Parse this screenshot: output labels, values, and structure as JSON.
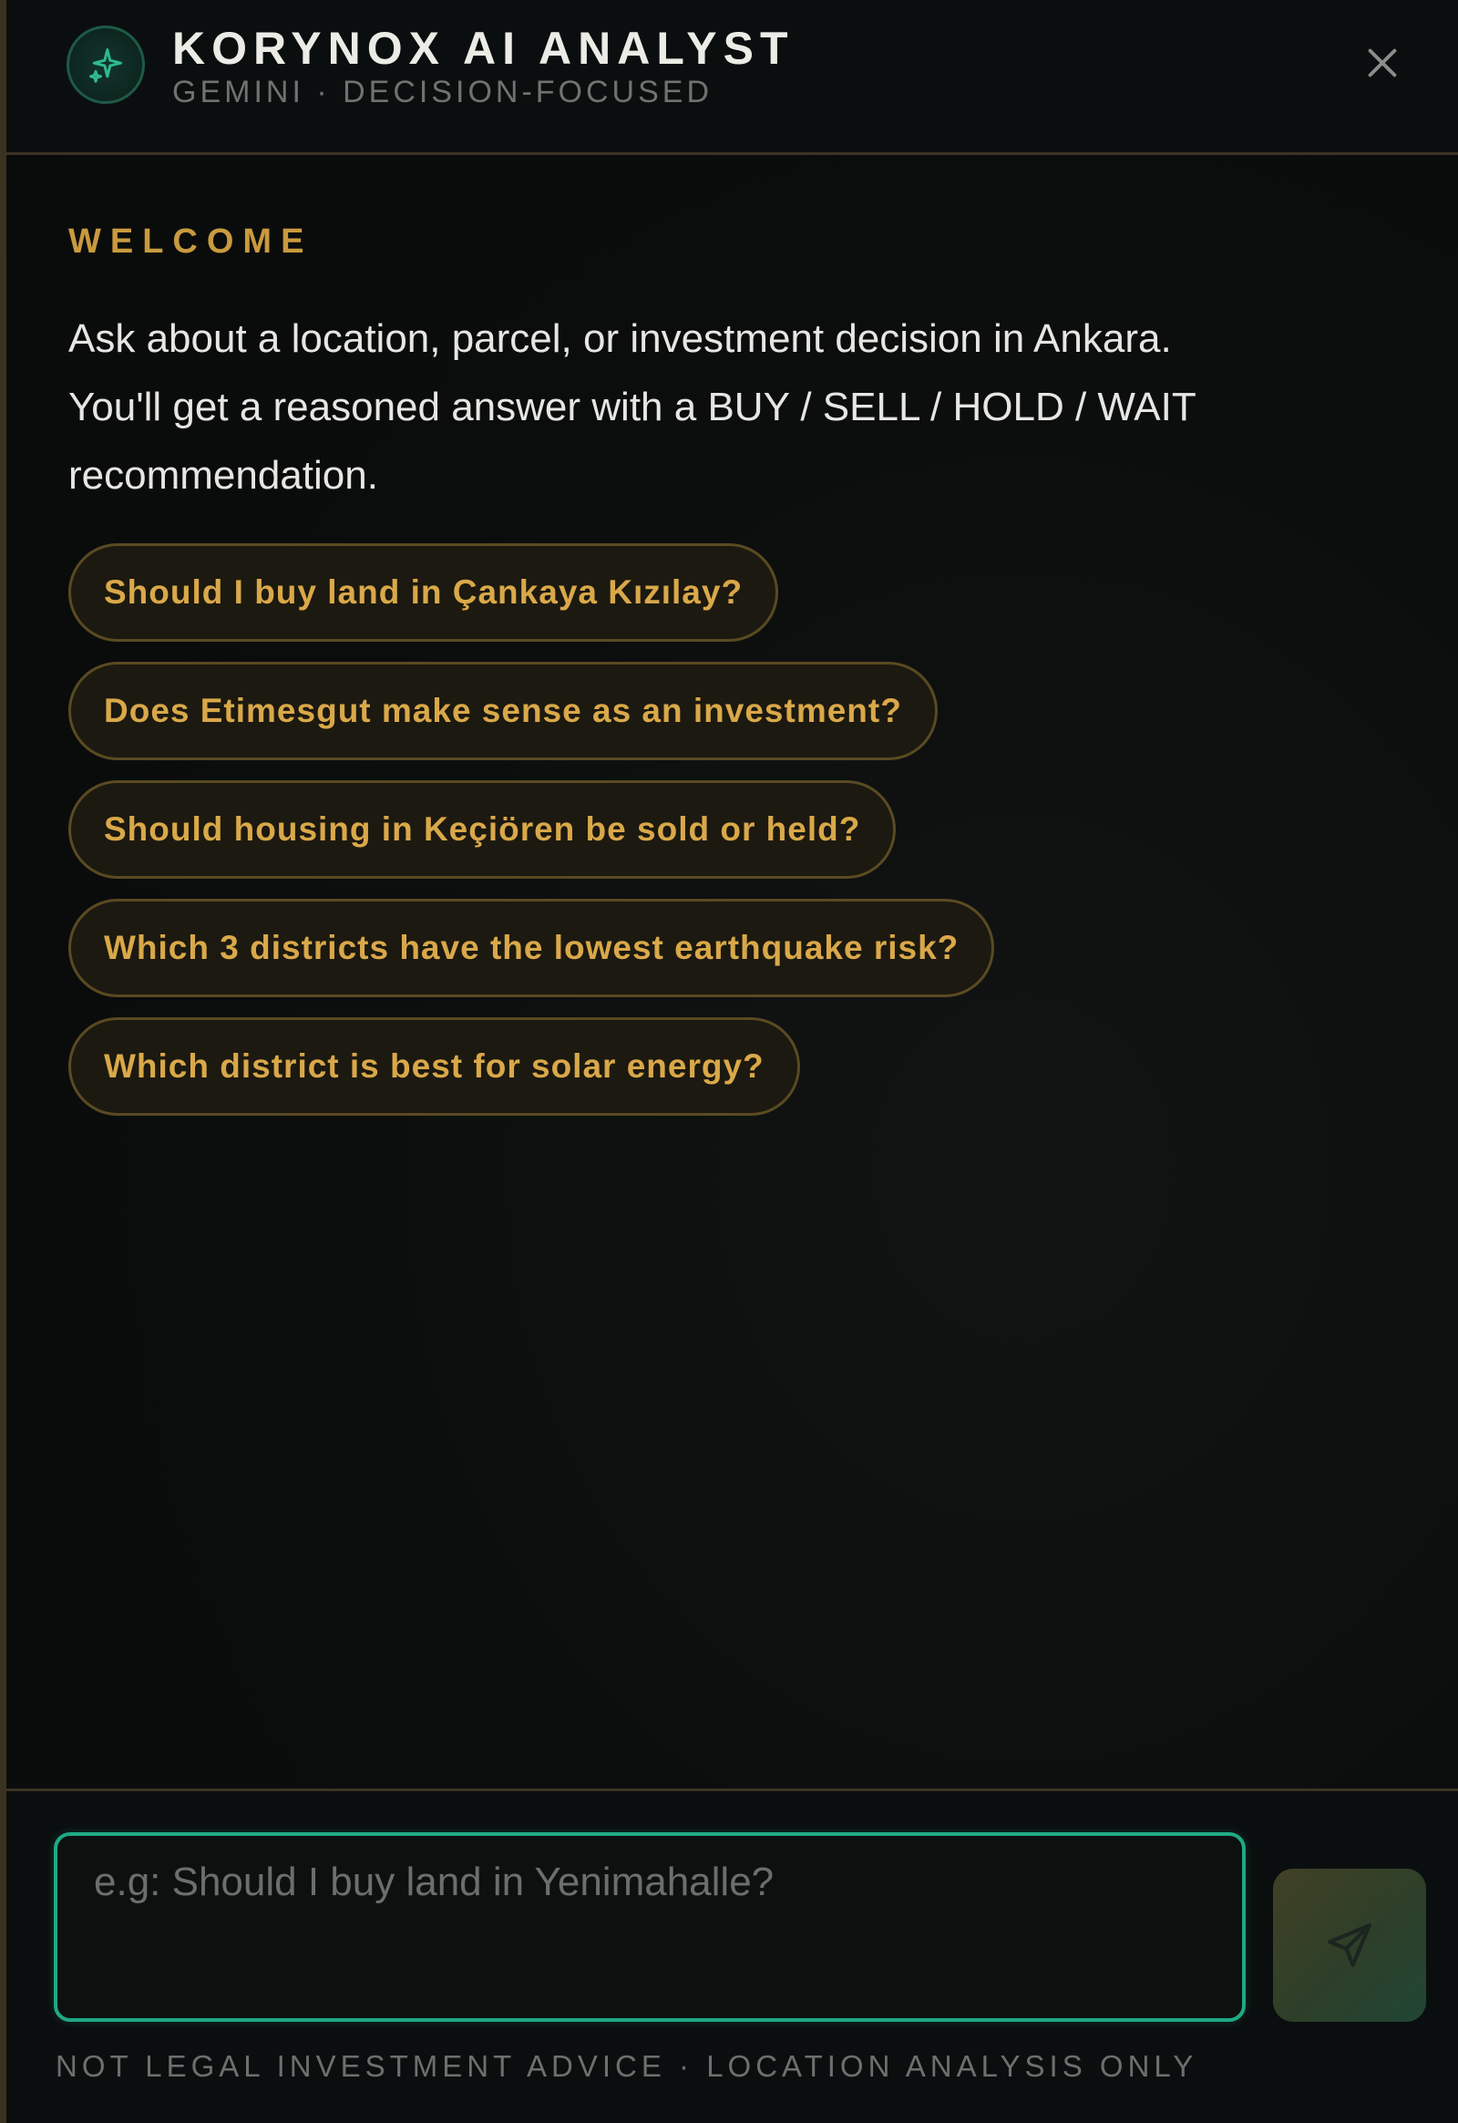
{
  "header": {
    "title": "KORYNOX AI ANALYST",
    "subtitle": "GEMINI · DECISION-FOCUSED",
    "logo_icon": "sparkle-icon",
    "close_icon": "close-icon"
  },
  "welcome": {
    "label": "WELCOME",
    "line1": "Ask about a location, parcel, or investment decision in Ankara.",
    "line2": "You'll get a reasoned answer with a BUY / SELL / HOLD / WAIT",
    "line3": "recommendation."
  },
  "suggestions": [
    "Should I buy land in Çankaya Kızılay?",
    "Does Etimesgut make sense as an investment?",
    "Should housing in Keçiören be sold or held?",
    "Which 3 districts have the lowest earthquake risk?",
    "Which district is best for solar energy?"
  ],
  "input": {
    "value": "",
    "placeholder": "e.g: Should I buy land in Yenimahalle?"
  },
  "send_icon": "send-icon",
  "disclaimer": "NOT LEGAL INVESTMENT ADVICE · LOCATION ANALYSIS ONLY",
  "colors": {
    "accent_gold": "#c99a3e",
    "accent_green": "#1fa985",
    "background": "#0a0c0c"
  }
}
